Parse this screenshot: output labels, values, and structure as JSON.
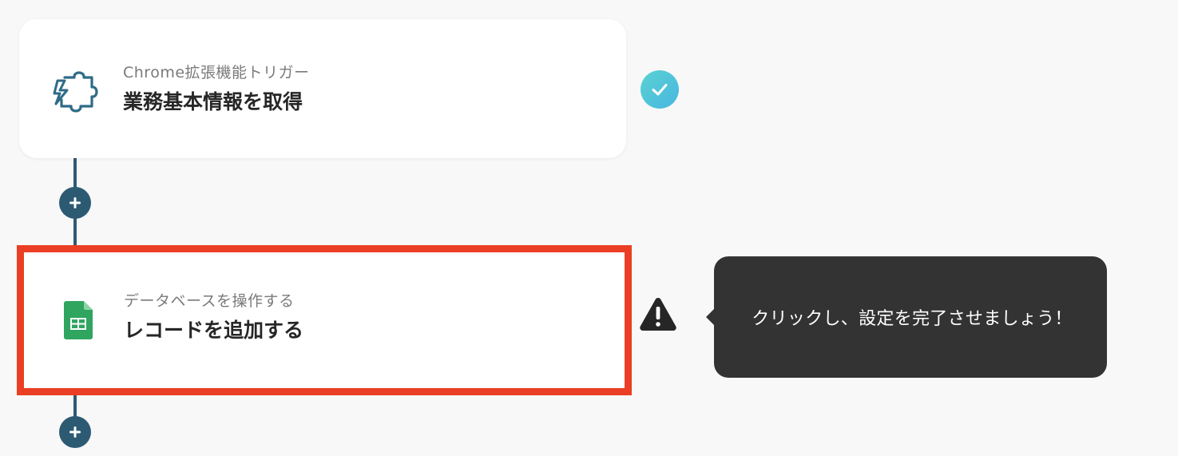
{
  "flow": {
    "steps": [
      {
        "subtitle": "Chrome拡張機能トリガー",
        "title": "業務基本情報を取得",
        "icon": "puzzle-lightning-icon",
        "status": "complete"
      },
      {
        "subtitle": "データベースを操作する",
        "title": "レコードを追加する",
        "icon": "google-sheets-icon",
        "status": "warning"
      }
    ]
  },
  "tooltip": {
    "text": "クリックし、設定を完了させましょう！"
  },
  "colors": {
    "connector": "#2d5a73",
    "highlight_border": "#ea3f24",
    "check_gradient_start": "#5ad2d2",
    "check_gradient_end": "#49b6e0",
    "tooltip_bg": "#333333",
    "sheets_green": "#2fa560"
  }
}
